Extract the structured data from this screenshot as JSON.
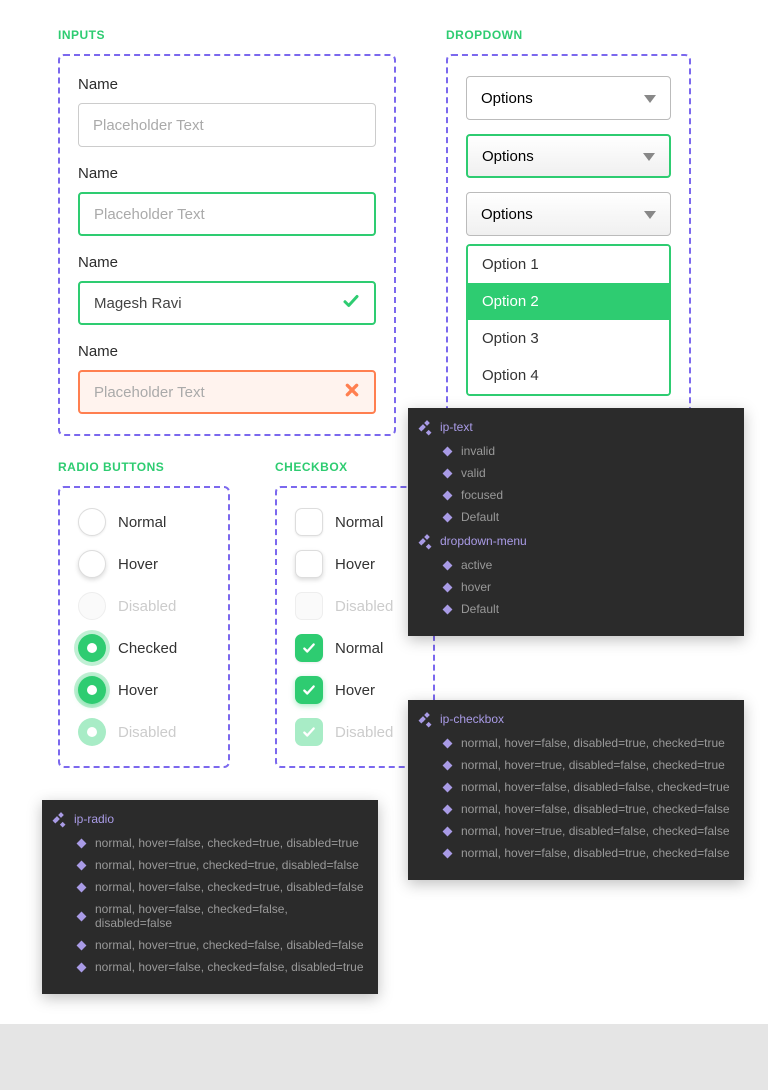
{
  "sections": {
    "inputs_title": "INPUTS",
    "dropdown_title": "DROPDOWN",
    "radio_title": "RADIO BUTTONS",
    "checkbox_title": "CHECKBOX"
  },
  "inputs": {
    "default": {
      "label": "Name",
      "placeholder": "Placeholder Text"
    },
    "focused": {
      "label": "Name",
      "placeholder": "Placeholder Text"
    },
    "valid": {
      "label": "Name",
      "value": "Magesh Ravi"
    },
    "invalid": {
      "label": "Name",
      "placeholder": "Placeholder Text"
    }
  },
  "dropdown": {
    "default_label": "Options",
    "hover_label": "Options",
    "active_label": "Options",
    "options": [
      "Option 1",
      "Option 2",
      "Option 3",
      "Option 4"
    ],
    "selected_index": 1
  },
  "radios": [
    {
      "label": "Normal",
      "checked": false,
      "hover": false,
      "disabled": false
    },
    {
      "label": "Hover",
      "checked": false,
      "hover": true,
      "disabled": false
    },
    {
      "label": "Disabled",
      "checked": false,
      "hover": false,
      "disabled": true
    },
    {
      "label": "Checked",
      "checked": true,
      "hover": false,
      "disabled": false
    },
    {
      "label": "Hover",
      "checked": true,
      "hover": true,
      "disabled": false
    },
    {
      "label": "Disabled",
      "checked": true,
      "hover": false,
      "disabled": true
    }
  ],
  "checkboxes": [
    {
      "label": "Normal",
      "checked": false,
      "hover": false,
      "disabled": false
    },
    {
      "label": "Hover",
      "checked": false,
      "hover": true,
      "disabled": false
    },
    {
      "label": "Disabled",
      "checked": false,
      "hover": false,
      "disabled": true
    },
    {
      "label": "Normal",
      "checked": true,
      "hover": false,
      "disabled": false
    },
    {
      "label": "Hover",
      "checked": true,
      "hover": true,
      "disabled": false
    },
    {
      "label": "Disabled",
      "checked": true,
      "hover": false,
      "disabled": true
    }
  ],
  "panel1": {
    "group1_title": "ip-text",
    "group1_items": [
      "invalid",
      "valid",
      "focused",
      "Default"
    ],
    "group2_title": "dropdown-menu",
    "group2_items": [
      "active",
      "hover",
      "Default"
    ]
  },
  "panel2": {
    "title": "ip-checkbox",
    "items": [
      "normal, hover=false, disabled=true, checked=true",
      "normal, hover=true, disabled=false, checked=true",
      "normal, hover=false, disabled=false, checked=true",
      "normal, hover=false, disabled=true, checked=false",
      "normal, hover=true, disabled=false, checked=false",
      "normal, hover=false, disabled=true, checked=false"
    ]
  },
  "panel3": {
    "title": "ip-radio",
    "items": [
      "normal, hover=false, checked=true, disabled=true",
      "normal, hover=true, checked=true, disabled=false",
      "normal, hover=false, checked=true, disabled=false",
      "normal, hover=false, checked=false, disabled=false",
      "normal, hover=true, checked=false, disabled=false",
      "normal, hover=false, checked=false, disabled=true"
    ]
  }
}
